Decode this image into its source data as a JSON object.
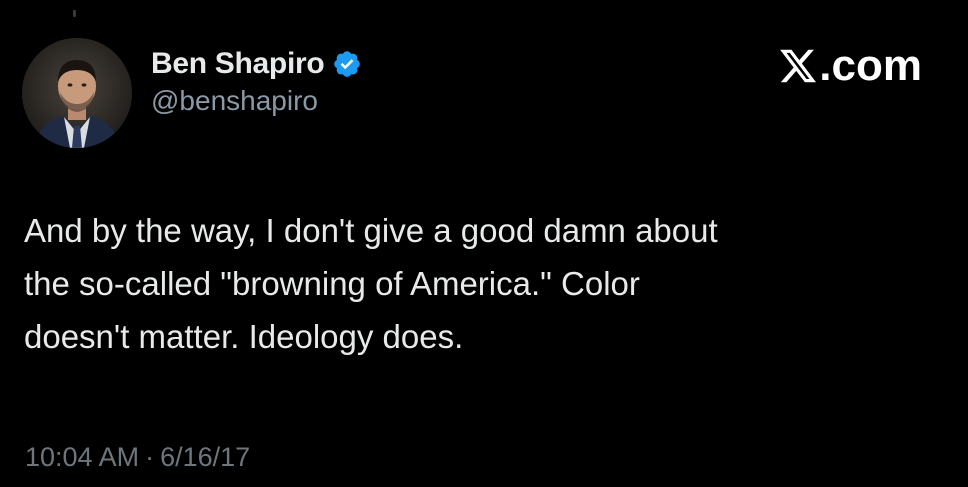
{
  "author": {
    "display_name": "Ben Shapiro",
    "handle": "@benshapiro",
    "verified": true,
    "avatar_icon": "profile-photo"
  },
  "brand": {
    "label": ".com",
    "logo_icon": "x-logo-icon"
  },
  "tweet": {
    "lines": [
      "And by the way, I don't give a good damn about",
      "the so-called \"browning of America.\" Color",
      "doesn't matter. Ideology does."
    ]
  },
  "meta": {
    "time": "10:04 AM",
    "separator": "·",
    "date": "6/16/17"
  },
  "colors": {
    "background": "#000000",
    "text_primary": "#e7e9ea",
    "text_secondary": "#8b98a5",
    "verified_blue": "#1d9bf0"
  }
}
